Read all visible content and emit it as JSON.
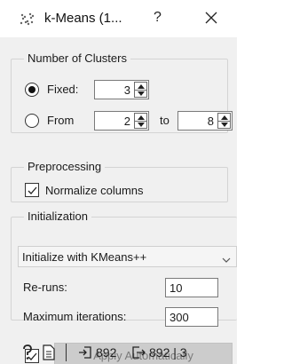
{
  "window": {
    "title": "k-Means (1...",
    "help_label": "?",
    "icon": "kmeans-scatter-icon"
  },
  "clusters": {
    "legend": "Number of Clusters",
    "fixed_label": "Fixed:",
    "fixed_value": "3",
    "from_label": "From",
    "from_value": "2",
    "to_label": "to",
    "to_value": "8",
    "selected": "fixed"
  },
  "preprocessing": {
    "legend": "Preprocessing",
    "normalize_label": "Normalize columns",
    "normalize_checked": true
  },
  "initialization": {
    "legend": "Initialization",
    "method": "Initialize with KMeans++",
    "reruns_label": "Re-runs:",
    "reruns_value": "10",
    "max_iter_label": "Maximum iterations:",
    "max_iter_value": "300"
  },
  "apply": {
    "auto_checked": true,
    "label": "Apply Automatically"
  },
  "status": {
    "help_icon": "help-icon",
    "report_icon": "report-icon",
    "input_count": "892",
    "output_count": "892 | 3"
  }
}
